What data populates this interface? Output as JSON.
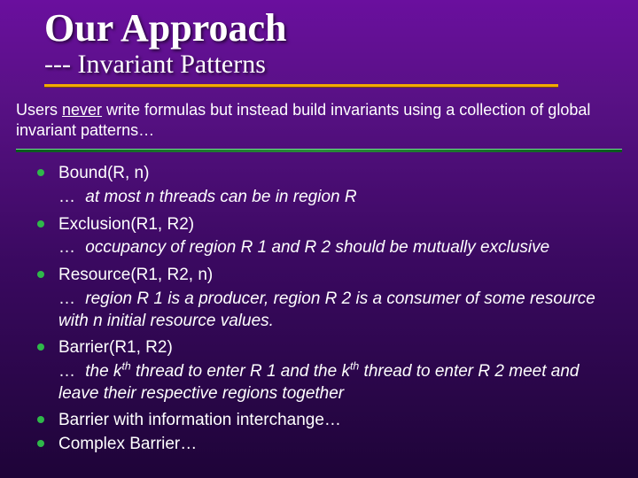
{
  "title": "Our Approach",
  "subtitle": "--- Invariant Patterns",
  "intro_pre": "Users ",
  "intro_never": "never",
  "intro_post": " write formulas but instead build invariants using a collection of global invariant patterns…",
  "items": [
    {
      "head": "Bound(R, n)",
      "sub_parts": [
        "…",
        " at most ",
        "n",
        " threads can be in region ",
        "R"
      ]
    },
    {
      "head": "Exclusion(R1, R2)",
      "sub_parts": [
        "…",
        " occupancy of region ",
        "R 1",
        " and ",
        "R 2",
        " should be mutually exclusive"
      ]
    },
    {
      "head": "Resource(R1, R2, n)",
      "sub_parts": [
        "…",
        " region ",
        "R 1",
        " is a producer, region ",
        "R 2",
        " is a consumer of some resource with ",
        "n",
        " initial resource values."
      ]
    },
    {
      "head": "Barrier(R1, R2)",
      "sub_parts": [
        "…",
        " the k",
        "th",
        " thread to enter ",
        "R 1",
        " and the k",
        "th",
        " thread to enter ",
        "R 2",
        " meet and leave their respective regions together"
      ]
    },
    {
      "head": "Barrier with information interchange…"
    },
    {
      "head": "Complex Barrier…"
    }
  ]
}
